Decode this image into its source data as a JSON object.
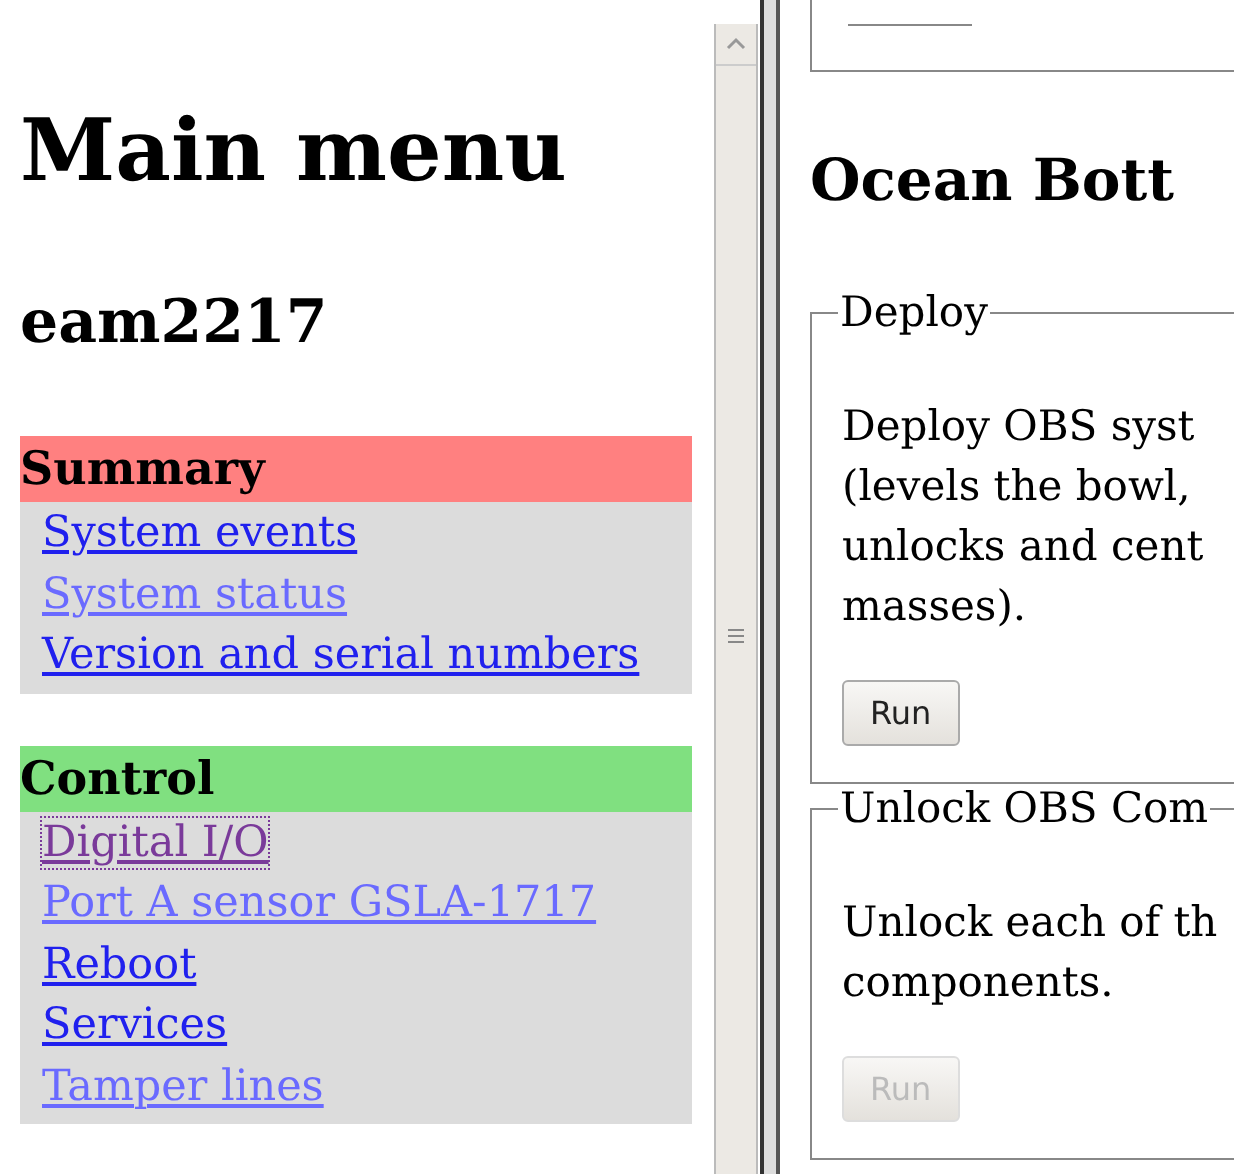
{
  "menu": {
    "title": "Main menu",
    "device": "eam2217",
    "sections": [
      {
        "title": "Summary",
        "color": "#ff8080",
        "links": [
          {
            "label": "System events",
            "visited": false,
            "dimmed": false,
            "focused": false
          },
          {
            "label": "System status",
            "visited": false,
            "dimmed": true,
            "focused": false
          },
          {
            "label": "Version and serial numbers",
            "visited": false,
            "dimmed": false,
            "focused": false
          }
        ]
      },
      {
        "title": "Control",
        "color": "#80e080",
        "links": [
          {
            "label": "Digital I/O",
            "visited": true,
            "dimmed": false,
            "focused": true
          },
          {
            "label": "Port A sensor GSLA-1717",
            "visited": false,
            "dimmed": true,
            "focused": false
          },
          {
            "label": "Reboot",
            "visited": false,
            "dimmed": false,
            "focused": false
          },
          {
            "label": "Services",
            "visited": false,
            "dimmed": false,
            "focused": false
          },
          {
            "label": "Tamper lines",
            "visited": false,
            "dimmed": true,
            "focused": false
          }
        ]
      }
    ]
  },
  "content": {
    "title": "Ocean Bott",
    "groups": [
      {
        "legend": "Deploy",
        "lines": [
          "Deploy OBS syst",
          "(levels the bowl,",
          "unlocks and cent",
          "masses)."
        ],
        "button": {
          "label": "Run",
          "disabled": false
        }
      },
      {
        "legend": "Unlock OBS Com",
        "lines": [
          "Unlock each of th",
          "components."
        ],
        "button": {
          "label": "Run",
          "disabled": true
        }
      }
    ]
  }
}
